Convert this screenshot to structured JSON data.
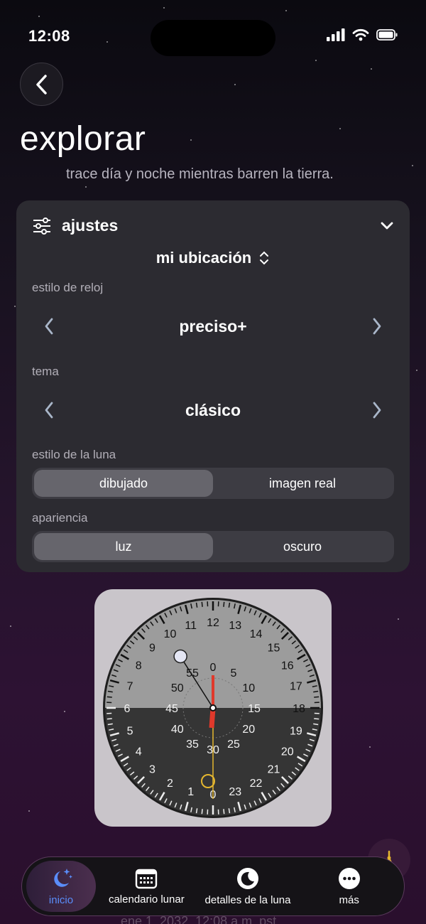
{
  "status_bar": {
    "time": "12:08"
  },
  "header": {
    "back_icon": "chevron-left-icon",
    "title": "explorar",
    "subtitle": "trace día y noche mientras barren la tierra."
  },
  "settings": {
    "header_label": "ajustes",
    "location": "mi ubicación",
    "clock_style": {
      "label": "estilo de reloj",
      "value": "preciso+"
    },
    "theme": {
      "label": "tema",
      "value": "clásico"
    },
    "moon_style": {
      "label": "estilo de la luna",
      "options": [
        "dibujado",
        "imagen real"
      ],
      "selected": "dibujado"
    },
    "appearance": {
      "label": "apariencia",
      "options": [
        "luz",
        "oscuro"
      ],
      "selected": "luz"
    }
  },
  "clock": {
    "outer_numbers": [
      "0",
      "1",
      "2",
      "3",
      "4",
      "5",
      "6",
      "7",
      "8",
      "9",
      "10",
      "11",
      "12",
      "13",
      "14",
      "15",
      "16",
      "17",
      "18",
      "19",
      "20",
      "21",
      "22",
      "23"
    ],
    "inner_numbers": [
      "0",
      "5",
      "10",
      "15",
      "20",
      "25",
      "30",
      "35",
      "40",
      "45",
      "50",
      "55"
    ],
    "colors": {
      "day": "#9c9c9c",
      "night": "#353535",
      "hand": "#e0392b",
      "sun": "#e5b72f"
    }
  },
  "footer": {
    "date": "ene 1, 2032, 12:08 a.m. pst"
  },
  "tabs": [
    {
      "label": "inicio",
      "icon": "moon-stars-icon",
      "active": true
    },
    {
      "label": "calendario lunar",
      "icon": "calendar-icon",
      "active": false
    },
    {
      "label": "detalles de la luna",
      "icon": "moon-icon",
      "active": false
    },
    {
      "label": "más",
      "icon": "more-icon",
      "active": false
    }
  ]
}
